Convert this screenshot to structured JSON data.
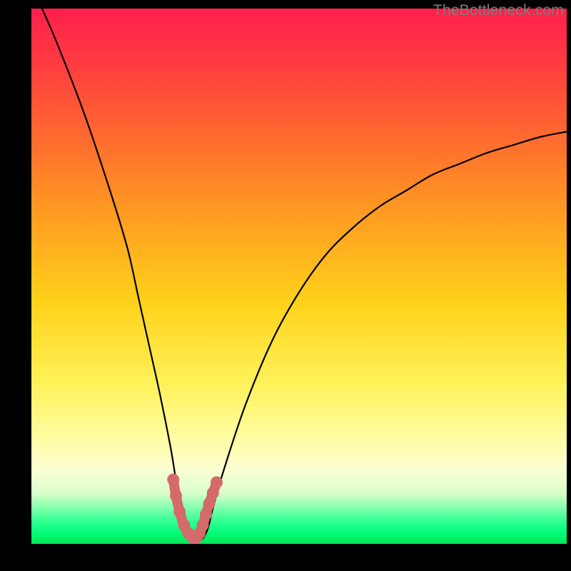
{
  "watermark": "TheBottleneck.com",
  "chart_data": {
    "type": "line",
    "title": "",
    "xlabel": "",
    "ylabel": "",
    "xlim": [
      0,
      100
    ],
    "ylim": [
      0,
      100
    ],
    "series": [
      {
        "name": "bottleneck-curve",
        "x": [
          2,
          5,
          10,
          15,
          18,
          20,
          22,
          24,
          26,
          27,
          28,
          29,
          30,
          31,
          32,
          33,
          34,
          36,
          40,
          45,
          50,
          55,
          60,
          65,
          70,
          75,
          80,
          85,
          90,
          95,
          100
        ],
        "y": [
          100,
          93,
          80,
          65,
          55,
          46,
          37,
          28,
          18,
          12,
          7,
          3,
          1,
          0.5,
          1,
          3,
          7,
          14,
          26,
          38,
          47,
          54,
          59,
          63,
          66,
          69,
          71,
          73,
          74.5,
          76,
          77
        ]
      },
      {
        "name": "trough-marker",
        "x": [
          26.5,
          27,
          27.7,
          28.5,
          29.3,
          30.1,
          30.9,
          31.4,
          32,
          32.6,
          33.2,
          33.9,
          34.6
        ],
        "y": [
          12,
          9,
          6,
          3.5,
          2,
          1.2,
          1.2,
          2,
          3.5,
          5.5,
          7.5,
          9.5,
          11.5
        ]
      }
    ],
    "gradient_stops": [
      {
        "pos": 0.0,
        "color": "#ff1f4c"
      },
      {
        "pos": 0.55,
        "color": "#ffd21a"
      },
      {
        "pos": 0.86,
        "color": "#fbffd2"
      },
      {
        "pos": 1.0,
        "color": "#00e653"
      }
    ]
  }
}
